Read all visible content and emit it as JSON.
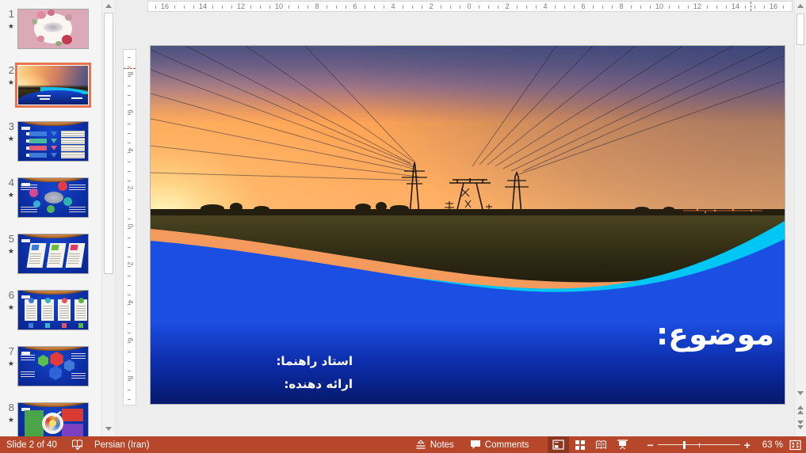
{
  "status_bar": {
    "slide_indicator": "Slide 2 of 40",
    "language": "Persian (Iran)",
    "notes_label": "Notes",
    "comments_label": "Comments",
    "zoom_level": "63 %",
    "view_buttons": [
      "Normal",
      "Slide Sorter",
      "Reading View",
      "Slide Show"
    ],
    "active_view": "Normal",
    "bg_color": "#B7472A"
  },
  "slide_panel": {
    "selected_number": "2",
    "thumbnails": [
      {
        "number": "1",
        "starred": true,
        "selected": false,
        "kind": "floral-title"
      },
      {
        "number": "2",
        "starred": true,
        "selected": true,
        "kind": "sunset-cover"
      },
      {
        "number": "3",
        "starred": true,
        "selected": false,
        "kind": "chevron-list"
      },
      {
        "number": "4",
        "starred": true,
        "selected": false,
        "kind": "circle-diagram"
      },
      {
        "number": "5",
        "starred": true,
        "selected": false,
        "kind": "slanted-cards"
      },
      {
        "number": "6",
        "starred": true,
        "selected": false,
        "kind": "four-cards"
      },
      {
        "number": "7",
        "starred": true,
        "selected": false,
        "kind": "hexagon-diagram"
      },
      {
        "number": "8",
        "starred": true,
        "selected": false,
        "kind": "target-quadrants"
      }
    ]
  },
  "rulers": {
    "horizontal": [
      "16",
      "14",
      "12",
      "10",
      "8",
      "6",
      "4",
      "2",
      "0",
      "2",
      "4",
      "6",
      "8",
      "10",
      "12",
      "14",
      "16"
    ],
    "vertical": [
      "8",
      "6",
      "4",
      "2",
      "0",
      "2",
      "4",
      "6",
      "8"
    ]
  },
  "slide": {
    "title": "موضوع:",
    "supervisor_label": "استاد راهنما:",
    "presenter_label": "ارائه دهنده:",
    "theme_colors": {
      "wave_blue_top": "#1B4EE2",
      "wave_blue_bottom": "#06196B",
      "wave_cyan": "#00C6F6",
      "wave_orange": "#EF8A4E",
      "selection_border": "#E8744E"
    }
  },
  "icons": {
    "spellcheck-icon": "open book with check mark",
    "notes-icon": "notes pane toggle",
    "comments-icon": "speech bubble",
    "normal-view-icon": "slide with panes",
    "slide-sorter-icon": "grid of slides",
    "reading-view-icon": "open book",
    "slideshow-icon": "projection screen",
    "zoom-out-icon": "minus",
    "zoom-in-icon": "plus",
    "fit-to-window-icon": "slide with corner arrows",
    "star-icon": "animation star"
  }
}
